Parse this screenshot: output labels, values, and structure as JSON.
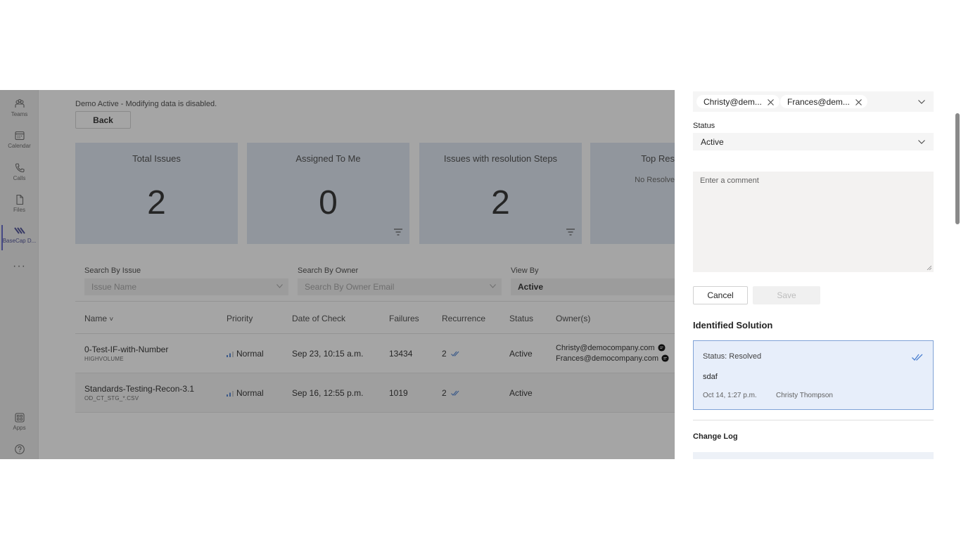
{
  "rail": {
    "items": [
      {
        "label": "Teams",
        "icon": "teams-icon"
      },
      {
        "label": "Calendar",
        "icon": "calendar-icon"
      },
      {
        "label": "Calls",
        "icon": "phone-icon"
      },
      {
        "label": "Files",
        "icon": "file-icon"
      },
      {
        "label": "BaseCap D...",
        "icon": "basecap-app-icon"
      },
      {
        "label": "Apps",
        "icon": "apps-icon"
      },
      {
        "label": "",
        "icon": "help-icon"
      }
    ],
    "more": "···"
  },
  "main": {
    "demo_note": "Demo Active - Modifying data is disabled.",
    "back_label": "Back",
    "cards": [
      {
        "title": "Total Issues",
        "value": "2"
      },
      {
        "title": "Assigned To Me",
        "value": "0"
      },
      {
        "title": "Issues with resolution Steps",
        "value": "2"
      },
      {
        "title": "Top Res",
        "subtitle": "No Resolve"
      }
    ],
    "filters": {
      "issue_label": "Search By Issue",
      "issue_placeholder": "Issue Name",
      "owner_label": "Search By Owner",
      "owner_placeholder": "Search By Owner Email",
      "viewby_label": "View By",
      "viewby_value": "Active"
    },
    "table": {
      "columns": [
        "Name",
        "Priority",
        "Date of Check",
        "Failures",
        "Recurrence",
        "Status",
        "Owner(s)"
      ],
      "sort_indicator": "˅",
      "rows": [
        {
          "name": "0-Test-IF-with-Number",
          "sub": "HIGHVOLUME",
          "priority": "Normal",
          "date": "Sep 23, 10:15 a.m.",
          "failures": "13434",
          "recurrence": "2",
          "status": "Active",
          "owner1": "Christy@democompany.com",
          "owner2": "Frances@democompany.com"
        },
        {
          "name": "Standards-Testing-Recon-3.1",
          "sub": "OD_CT_STG_*.CSV",
          "priority": "Normal",
          "date": "Sep 16, 12:55 p.m.",
          "failures": "1019",
          "recurrence": "2",
          "status": "Active"
        }
      ]
    }
  },
  "panel": {
    "owners": [
      "Christy@dem...",
      "Frances@dem..."
    ],
    "status_label": "Status",
    "status_value": "Active",
    "comment_placeholder": "Enter a comment",
    "cancel_label": "Cancel",
    "save_label": "Save",
    "solution_title": "Identified Solution",
    "solution": {
      "status_text": "Status: Resolved",
      "text": "sdaf",
      "date": "Oct 14, 1:27 p.m.",
      "author": "Christy Thompson"
    },
    "changelog_title": "Change Log"
  },
  "colors": {
    "card_bg": "#dce6f2",
    "accent": "#5b5fc7",
    "solution_bg": "#e7eefa",
    "solution_border": "#7fa2d6",
    "check_blue": "#4a7fd0"
  }
}
